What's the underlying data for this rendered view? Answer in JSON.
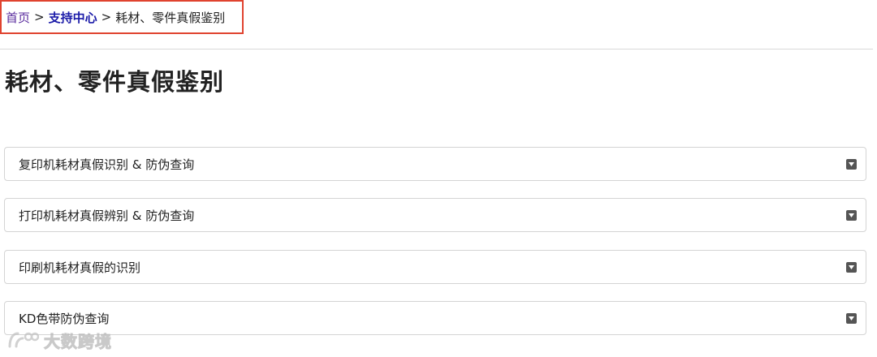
{
  "breadcrumb": {
    "home": "首页",
    "separator": ">",
    "support": "支持中心",
    "current": "耗材、零件真假鉴别"
  },
  "page": {
    "title": "耗材、零件真假鉴别"
  },
  "accordion": {
    "items": [
      {
        "label": "复印机耗材真假识别 & 防伪查询"
      },
      {
        "label": "打印机耗材真假辨别 & 防伪查询"
      },
      {
        "label": "印刷机耗材真假的识别"
      },
      {
        "label": "KD色带防伪查询"
      }
    ],
    "expand_icon": "caret-down-icon"
  },
  "watermark": {
    "text": "大数跨境"
  },
  "colors": {
    "breadcrumb_highlight_border": "#e0432f",
    "link_visited": "#5a2c9e",
    "link": "#1a1aa8",
    "divider": "#d9d9d9",
    "item_border": "#d4d4d4",
    "caret_box": "#555555"
  }
}
